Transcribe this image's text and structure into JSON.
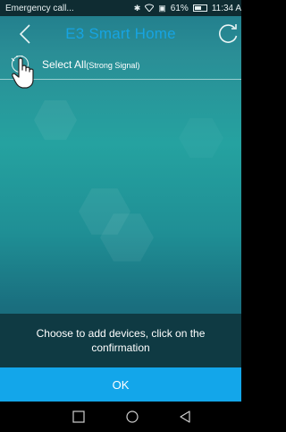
{
  "status_bar": {
    "carrier": "Emergency call...",
    "battery_percent": "61%",
    "battery_level": 0.61,
    "time": "11:34 A"
  },
  "header": {
    "title": "E3 Smart Home",
    "back_icon": "chevron-left-icon",
    "refresh_icon": "refresh-icon"
  },
  "select_all": {
    "label": "Select All",
    "note": "(Strong Signal)",
    "checked": false
  },
  "hint": {
    "text": "Choose to add devices, click on the confirmation"
  },
  "ok_button": {
    "label": "OK"
  },
  "colors": {
    "accent": "#13a6ea",
    "title": "#17a4e2",
    "hint_background": "#0f3a43"
  }
}
